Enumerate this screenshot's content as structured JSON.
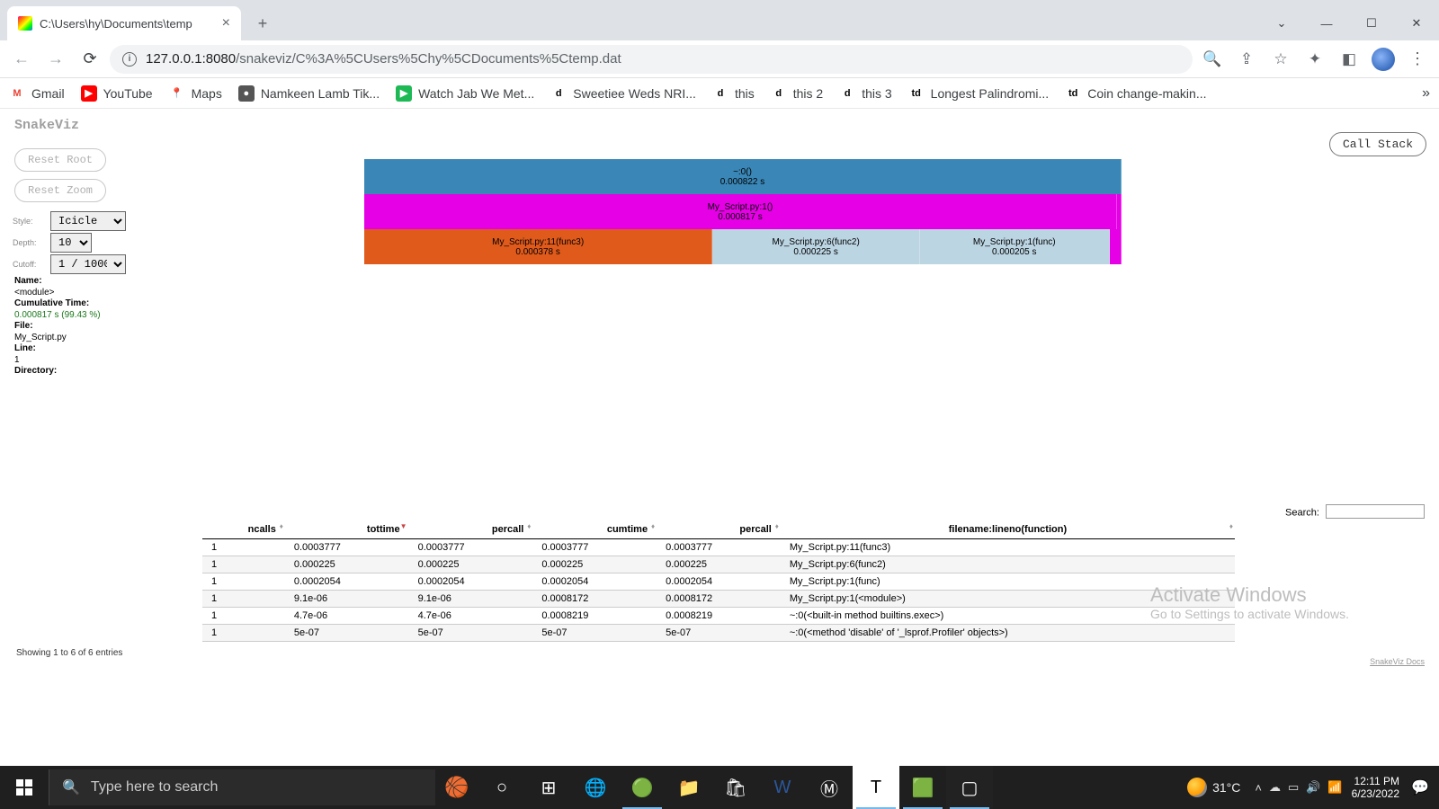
{
  "browser": {
    "tab_title": "C:\\Users\\hy\\Documents\\temp",
    "url_host": "127.0.0.1",
    "url_port": ":8080",
    "url_path": "/snakeviz/C%3A%5CUsers%5Chy%5CDocuments%5Ctemp.dat"
  },
  "bookmarks": [
    {
      "label": "Gmail",
      "icon_bg": "#fff",
      "icon_fg": "#ea4335",
      "icon_txt": "M"
    },
    {
      "label": "YouTube",
      "icon_bg": "#ff0000",
      "icon_fg": "#fff",
      "icon_txt": "▶"
    },
    {
      "label": "Maps",
      "icon_bg": "#fff",
      "icon_fg": "#34a853",
      "icon_txt": "📍"
    },
    {
      "label": "Namkeen Lamb Tik...",
      "icon_bg": "#555",
      "icon_fg": "#fff",
      "icon_txt": "●"
    },
    {
      "label": "Watch Jab We Met...",
      "icon_bg": "#1db954",
      "icon_fg": "#fff",
      "icon_txt": "▶"
    },
    {
      "label": "Sweetiee Weds NRI...",
      "icon_bg": "#fff",
      "icon_fg": "#000",
      "icon_txt": "d"
    },
    {
      "label": "this",
      "icon_bg": "#fff",
      "icon_fg": "#000",
      "icon_txt": "d"
    },
    {
      "label": "this 2",
      "icon_bg": "#fff",
      "icon_fg": "#000",
      "icon_txt": "d"
    },
    {
      "label": "this 3",
      "icon_bg": "#fff",
      "icon_fg": "#000",
      "icon_txt": "d"
    },
    {
      "label": "Longest Palindromi...",
      "icon_bg": "#fff",
      "icon_fg": "#000",
      "icon_txt": "td"
    },
    {
      "label": "Coin change-makin...",
      "icon_bg": "#fff",
      "icon_fg": "#000",
      "icon_txt": "td"
    }
  ],
  "app": {
    "title": "SnakeViz",
    "reset_root": "Reset Root",
    "reset_zoom": "Reset Zoom",
    "call_stack": "Call Stack",
    "style_label": "Style:",
    "style_value": "Icicle",
    "depth_label": "Depth:",
    "depth_value": "10",
    "cutoff_label": "Cutoff:",
    "cutoff_value": "1 / 1000",
    "info": {
      "name_label": "Name:",
      "name_value": "<module>",
      "cumtime_label": "Cumulative Time:",
      "cumtime_value": "0.000817 s (99.43 %)",
      "file_label": "File:",
      "file_value": "My_Script.py",
      "line_label": "Line:",
      "line_value": "1",
      "dir_label": "Directory:"
    },
    "search_label": "Search:",
    "entries_info": "Showing 1 to 6 of 6 entries",
    "docs_link": "SnakeViz Docs"
  },
  "chart_data": {
    "type": "icicle",
    "total_time_s": 0.000822,
    "rows": [
      [
        {
          "label": "~:0(<built-in method builtins.exec>)",
          "time": "0.000822 s",
          "frac": 1.0,
          "color": "#3a87b7"
        }
      ],
      [
        {
          "label": "My_Script.py:1(<module>)",
          "time": "0.000817 s",
          "frac": 0.994,
          "color": "#e600e6"
        },
        {
          "label": "",
          "time": "",
          "frac": 0.006,
          "color": "#e600e6"
        }
      ],
      [
        {
          "label": "My_Script.py:11(func3)",
          "time": "0.000378 s",
          "frac": 0.46,
          "color": "#e05a1c"
        },
        {
          "label": "My_Script.py:6(func2)",
          "time": "0.000225 s",
          "frac": 0.274,
          "color": "#bcd5e3"
        },
        {
          "label": "My_Script.py:1(func)",
          "time": "0.000205 s",
          "frac": 0.25,
          "color": "#bcd5e3"
        },
        {
          "label": "",
          "time": "",
          "frac": 0.016,
          "color": "#e600e6"
        }
      ]
    ]
  },
  "table": {
    "headers": [
      "ncalls",
      "tottime",
      "percall",
      "cumtime",
      "percall",
      "filename:lineno(function)"
    ],
    "sorted_col": 1,
    "rows": [
      [
        "1",
        "0.0003777",
        "0.0003777",
        "0.0003777",
        "0.0003777",
        "My_Script.py:11(func3)"
      ],
      [
        "1",
        "0.000225",
        "0.000225",
        "0.000225",
        "0.000225",
        "My_Script.py:6(func2)"
      ],
      [
        "1",
        "0.0002054",
        "0.0002054",
        "0.0002054",
        "0.0002054",
        "My_Script.py:1(func)"
      ],
      [
        "1",
        "9.1e-06",
        "9.1e-06",
        "0.0008172",
        "0.0008172",
        "My_Script.py:1(<module>)"
      ],
      [
        "1",
        "4.7e-06",
        "4.7e-06",
        "0.0008219",
        "0.0008219",
        "~:0(<built-in method builtins.exec>)"
      ],
      [
        "1",
        "5e-07",
        "5e-07",
        "5e-07",
        "5e-07",
        "~:0(<method 'disable' of '_lsprof.Profiler' objects>)"
      ]
    ]
  },
  "watermark": {
    "title": "Activate Windows",
    "sub": "Go to Settings to activate Windows."
  },
  "taskbar": {
    "search_placeholder": "Type here to search",
    "temp": "31°C",
    "time": "12:11 PM",
    "date": "6/23/2022"
  }
}
